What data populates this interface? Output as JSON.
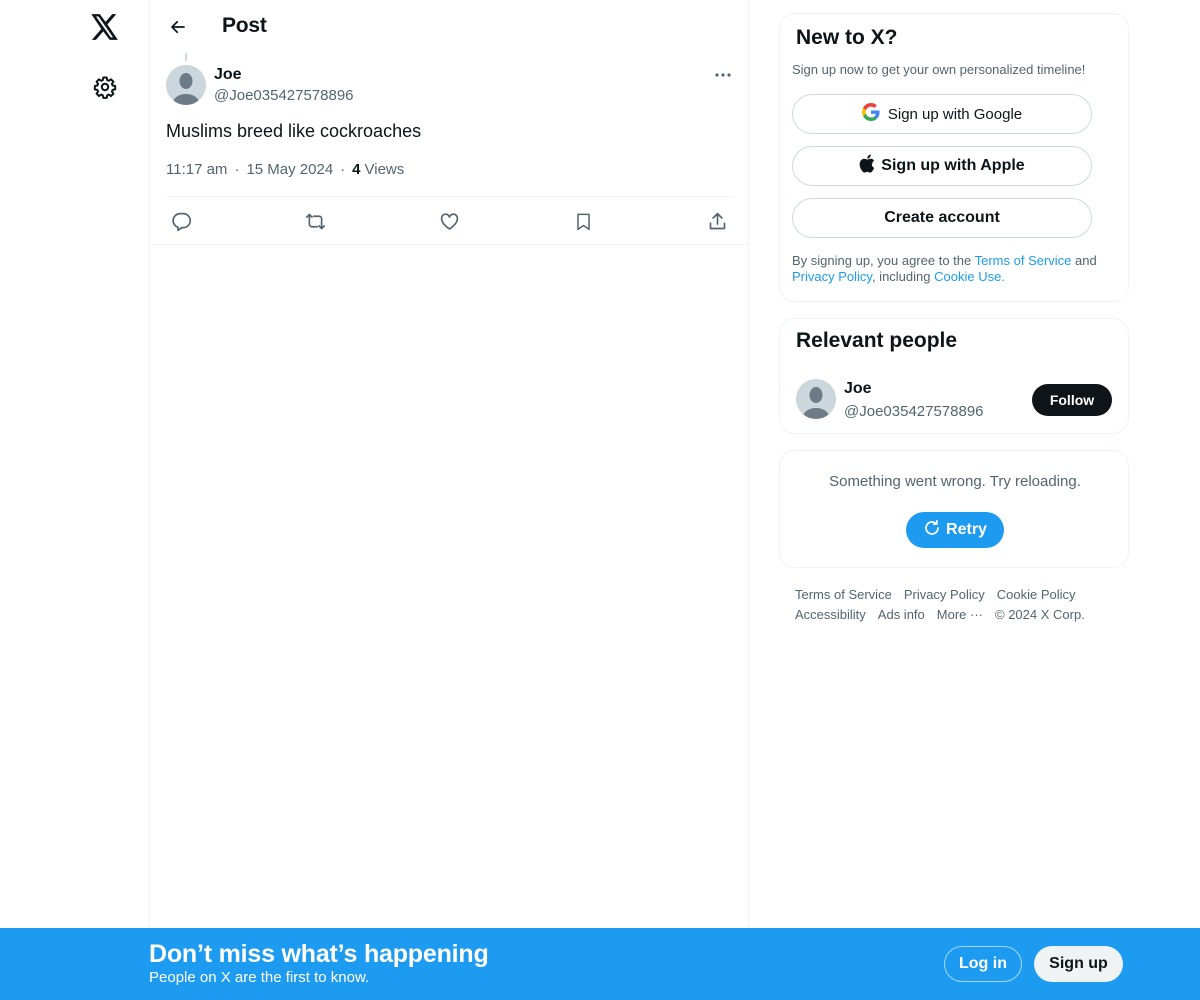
{
  "nav": {
    "logo_icon": "x-logo-icon",
    "settings_icon": "gear-icon"
  },
  "header": {
    "back_icon": "arrow-left-icon",
    "title": "Post"
  },
  "post": {
    "author": {
      "name": "Joe",
      "handle": "@Joe035427578896"
    },
    "text": "Muslims breed like cockroaches",
    "time": "11:17 am",
    "date": "15 May 2024",
    "separator": "·",
    "views_count": "4",
    "views_label": "Views",
    "actions": [
      "reply-icon",
      "repost-icon",
      "like-icon",
      "bookmark-icon",
      "share-icon"
    ]
  },
  "signup_card": {
    "title": "New to X?",
    "subtitle": "Sign up now to get your own personalized timeline!",
    "google_label": "Sign up with Google",
    "apple_label": "Sign up with Apple",
    "create_label": "Create account",
    "legal_prefix": "By signing up, you agree to the ",
    "terms_link": "Terms of Service",
    "legal_and": " and ",
    "privacy_link": "Privacy Policy",
    "legal_including": ", including ",
    "cookie_link": "Cookie Use."
  },
  "relevant_people": {
    "title": "Relevant people",
    "person": {
      "name": "Joe",
      "handle": "@Joe035427578896"
    },
    "follow_label": "Follow"
  },
  "error_card": {
    "message": "Something went wrong. Try reloading.",
    "retry_label": "Retry"
  },
  "footer": {
    "links": [
      "Terms of Service",
      "Privacy Policy",
      "Cookie Policy",
      "Accessibility",
      "Ads info",
      "More ···"
    ],
    "copyright": "© 2024 X Corp."
  },
  "banner": {
    "title": "Don’t miss what’s happening",
    "subtitle": "People on X are the first to know.",
    "login_label": "Log in",
    "signup_label": "Sign up"
  },
  "colors": {
    "accent": "#1d9bf0",
    "text_primary": "#0f1419",
    "text_secondary": "#536471",
    "border": "#eff3f4"
  }
}
